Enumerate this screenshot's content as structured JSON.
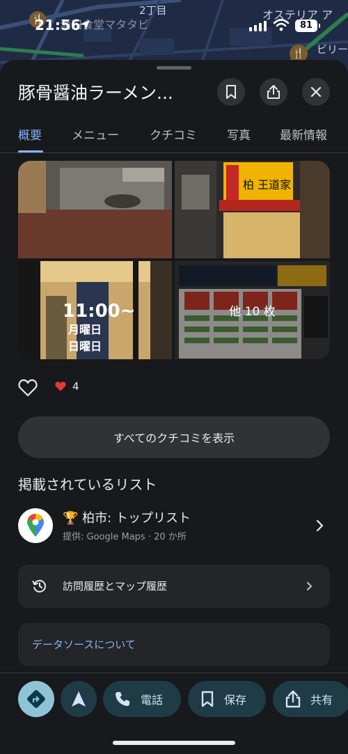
{
  "map": {
    "labels": [
      "2丁目",
      "オステリア ア",
      "ビリー",
      "酒田食堂マタタビ"
    ]
  },
  "status_bar": {
    "time": "21:56",
    "battery": "81"
  },
  "place": {
    "title": "豚骨醤油ラーメン..."
  },
  "tabs": [
    "概要",
    "メニュー",
    "クチコミ",
    "写真",
    "最新情報"
  ],
  "photos": {
    "more_label": "他 10 枚",
    "sign_text": "柏 王道家",
    "hours_text": "11:00~",
    "weekday_text": "月曜日",
    "sunday_text": "日曜日"
  },
  "likes": {
    "count": "4"
  },
  "buttons": {
    "all_reviews": "すべてのクチコミを表示"
  },
  "lists_section": {
    "title": "掲載されているリスト",
    "items": [
      {
        "emoji": "🏆",
        "name": "柏市: トップリスト",
        "sub": "提供: Google Maps · 20 か所"
      }
    ]
  },
  "history_card": {
    "label": "訪問履歴とマップ履歴"
  },
  "data_source_card": {
    "label": "データソースについて"
  },
  "action_bar": {
    "call": "電話",
    "save": "保存",
    "share": "共有"
  },
  "colors": {
    "accent": "#8ab4f8",
    "sheet_bg": "#17191c",
    "action_bg": "#1e3b46",
    "directions_bg": "#8fc4d6"
  }
}
